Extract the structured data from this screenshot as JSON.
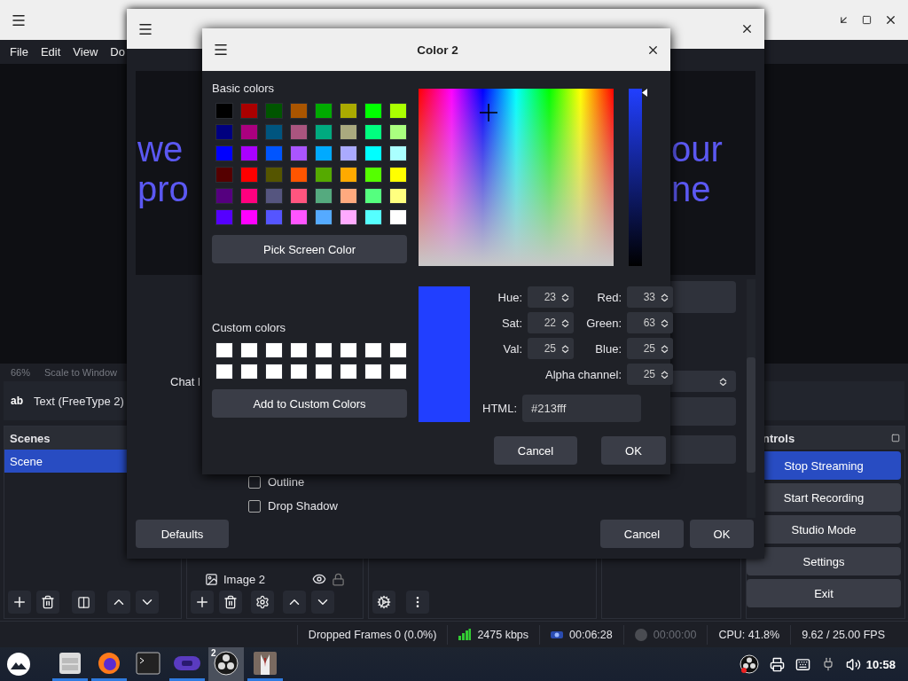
{
  "main_window": {
    "menu": [
      "File",
      "Edit",
      "View",
      "Do"
    ],
    "zoom": "66%",
    "scale_mode": "Scale to Window",
    "source_toolbar": {
      "icon_text": "ab",
      "source": "Text (FreeType 2)"
    },
    "scenes": {
      "title": "Scenes",
      "items": [
        {
          "name": "Scene",
          "selected": true
        }
      ]
    },
    "sources": {
      "items": [
        {
          "name": "Image 2"
        }
      ]
    },
    "controls": {
      "title": "ntrols",
      "buttons": [
        {
          "label": "Stop Streaming",
          "active": true
        },
        {
          "label": "Start Recording",
          "active": false
        },
        {
          "label": "Studio Mode",
          "active": false
        },
        {
          "label": "Settings",
          "active": false
        },
        {
          "label": "Exit",
          "active": false
        }
      ]
    },
    "status_bar": {
      "dropped_frames": "Dropped Frames 0 (0.0%)",
      "bitrate": "2475 kbps",
      "stream_time": "00:06:28",
      "record_time": "00:00:00",
      "cpu": "CPU: 41.8%",
      "fps": "9.62 / 25.00 FPS"
    }
  },
  "properties_dialog": {
    "preview_lines": [
      {
        "left": "we",
        "right": "our"
      },
      {
        "left": "pro",
        "right": "ne"
      }
    ],
    "chat_label": "Chat l",
    "checkboxes": [
      {
        "label": "Outline",
        "checked": false
      },
      {
        "label": "Drop Shadow",
        "checked": false
      }
    ],
    "buttons": {
      "defaults": "Defaults",
      "cancel": "Cancel",
      "ok": "OK"
    }
  },
  "color_dialog": {
    "title": "Color 2",
    "basic_colors_label": "Basic colors",
    "basic_colors": [
      {
        "color": "#000000"
      },
      {
        "color": "#aa0000"
      },
      {
        "color": "#005500"
      },
      {
        "color": "#aa5500"
      },
      {
        "color": "#00aa00"
      },
      {
        "color": "#aaaa00"
      },
      {
        "color": "#00ff00"
      },
      {
        "color": "#aaff00"
      },
      {
        "color": "#00007f"
      },
      {
        "color": "#aa007f"
      },
      {
        "color": "#00557f"
      },
      {
        "color": "#aa557f"
      },
      {
        "color": "#00aa7f"
      },
      {
        "color": "#aaaa7f"
      },
      {
        "color": "#00ff7f"
      },
      {
        "color": "#aaff7f"
      },
      {
        "color": "#0000ff"
      },
      {
        "color": "#aa00ff"
      },
      {
        "color": "#0055ff"
      },
      {
        "color": "#aa55ff"
      },
      {
        "color": "#00aaff"
      },
      {
        "color": "#aaaaff"
      },
      {
        "color": "#00ffff"
      },
      {
        "color": "#aaffff"
      },
      {
        "color": "#550000"
      },
      {
        "color": "#ff0000"
      },
      {
        "color": "#555500"
      },
      {
        "color": "#ff5500"
      },
      {
        "color": "#55aa00"
      },
      {
        "color": "#ffaa00"
      },
      {
        "color": "#55ff00"
      },
      {
        "color": "#ffff00"
      },
      {
        "color": "#55007f"
      },
      {
        "color": "#ff007f"
      },
      {
        "color": "#55557f"
      },
      {
        "color": "#ff557f"
      },
      {
        "color": "#55aa7f"
      },
      {
        "color": "#ffaa7f"
      },
      {
        "color": "#55ff7f"
      },
      {
        "color": "#ffff7f"
      },
      {
        "color": "#5500ff"
      },
      {
        "color": "#ff00ff"
      },
      {
        "color": "#5555ff"
      },
      {
        "color": "#ff55ff"
      },
      {
        "color": "#55aaff"
      },
      {
        "color": "#ffaaff"
      },
      {
        "color": "#55ffff"
      },
      {
        "color": "#ffffff"
      }
    ],
    "pick_screen": "Pick Screen Color",
    "custom_colors_label": "Custom colors",
    "custom_colors": [
      {
        "color": "#ffffff"
      },
      {
        "color": "#ffffff"
      },
      {
        "color": "#ffffff"
      },
      {
        "color": "#ffffff"
      },
      {
        "color": "#ffffff"
      },
      {
        "color": "#ffffff"
      },
      {
        "color": "#ffffff"
      },
      {
        "color": "#ffffff"
      },
      {
        "color": "#ffffff"
      },
      {
        "color": "#ffffff"
      },
      {
        "color": "#ffffff"
      },
      {
        "color": "#ffffff"
      },
      {
        "color": "#ffffff"
      },
      {
        "color": "#ffffff"
      },
      {
        "color": "#ffffff"
      },
      {
        "color": "#ffffff"
      }
    ],
    "add_custom": "Add to Custom Colors",
    "fields": [
      {
        "label": "Hue:",
        "value": "23"
      },
      {
        "label": "Red:",
        "value": "33"
      },
      {
        "label": "Sat:",
        "value": "22"
      },
      {
        "label": "Green:",
        "value": "63"
      },
      {
        "label": "Val:",
        "value": "25"
      },
      {
        "label": "Blue:",
        "value": "25"
      },
      {
        "label": "Alpha channel:",
        "value": "25"
      }
    ],
    "value_slider": {
      "level": 1
    },
    "html_label": "HTML:",
    "html": "#213fff",
    "buttons": [
      "Cancel",
      "OK"
    ]
  },
  "taskbar": {
    "apps": [
      {
        "kind": "files",
        "running": true,
        "selected": false
      },
      {
        "kind": "browser",
        "running": true,
        "selected": false
      },
      {
        "kind": "terminal",
        "running": false,
        "selected": false
      },
      {
        "kind": "gamepad",
        "running": true,
        "selected": false
      },
      {
        "kind": "obs",
        "running": false,
        "selected": true,
        "badge": "2"
      },
      {
        "kind": "suit",
        "running": true,
        "selected": false
      }
    ],
    "clock": "10:58"
  }
}
